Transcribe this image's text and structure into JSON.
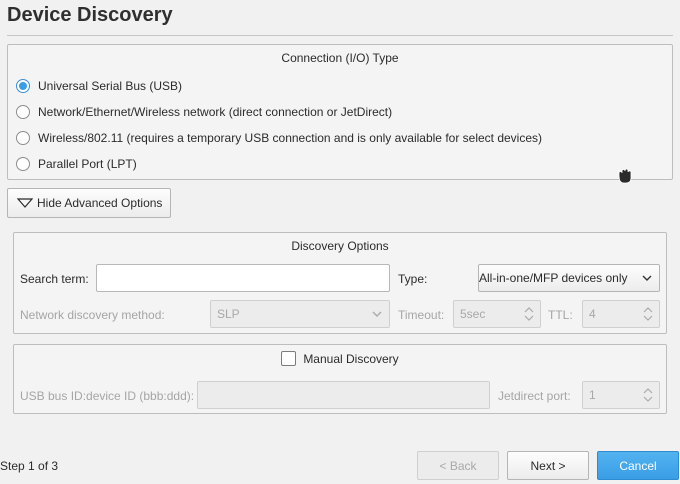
{
  "window": {
    "title": "Device Discovery"
  },
  "connection": {
    "group_title": "Connection (I/O) Type",
    "options": [
      {
        "label": "Universal Serial Bus (USB)",
        "selected": true
      },
      {
        "label": "Network/Ethernet/Wireless network (direct connection or JetDirect)",
        "selected": false
      },
      {
        "label": "Wireless/802.11 (requires a temporary USB connection and is only available for select devices)",
        "selected": false
      },
      {
        "label": "Parallel Port (LPT)",
        "selected": false
      }
    ]
  },
  "advanced_toggle": {
    "label": "Hide Advanced Options",
    "icon": "triangle-down-icon"
  },
  "discovery": {
    "group_title": "Discovery Options",
    "search_label": "Search term:",
    "search_value": "",
    "type_label": "Type:",
    "type_value": "All-in-one/MFP devices only",
    "method_label": "Network discovery method:",
    "method_value": "SLP",
    "timeout_label": "Timeout:",
    "timeout_value": "5sec",
    "ttl_label": "TTL:",
    "ttl_value": "4"
  },
  "manual": {
    "label": "Manual Discovery",
    "checked": false,
    "usb_label": "USB bus ID:device ID (bbb:ddd):",
    "usb_value": "",
    "port_label": "Jetdirect port:",
    "port_value": "1"
  },
  "footer": {
    "step_text": "Step 1 of 3",
    "back_label": "< Back",
    "next_label": "Next >",
    "cancel_label": "Cancel"
  },
  "colors": {
    "accent": "#3a9ee6",
    "background": "#f1f1f1",
    "border": "#bdbdbd"
  }
}
